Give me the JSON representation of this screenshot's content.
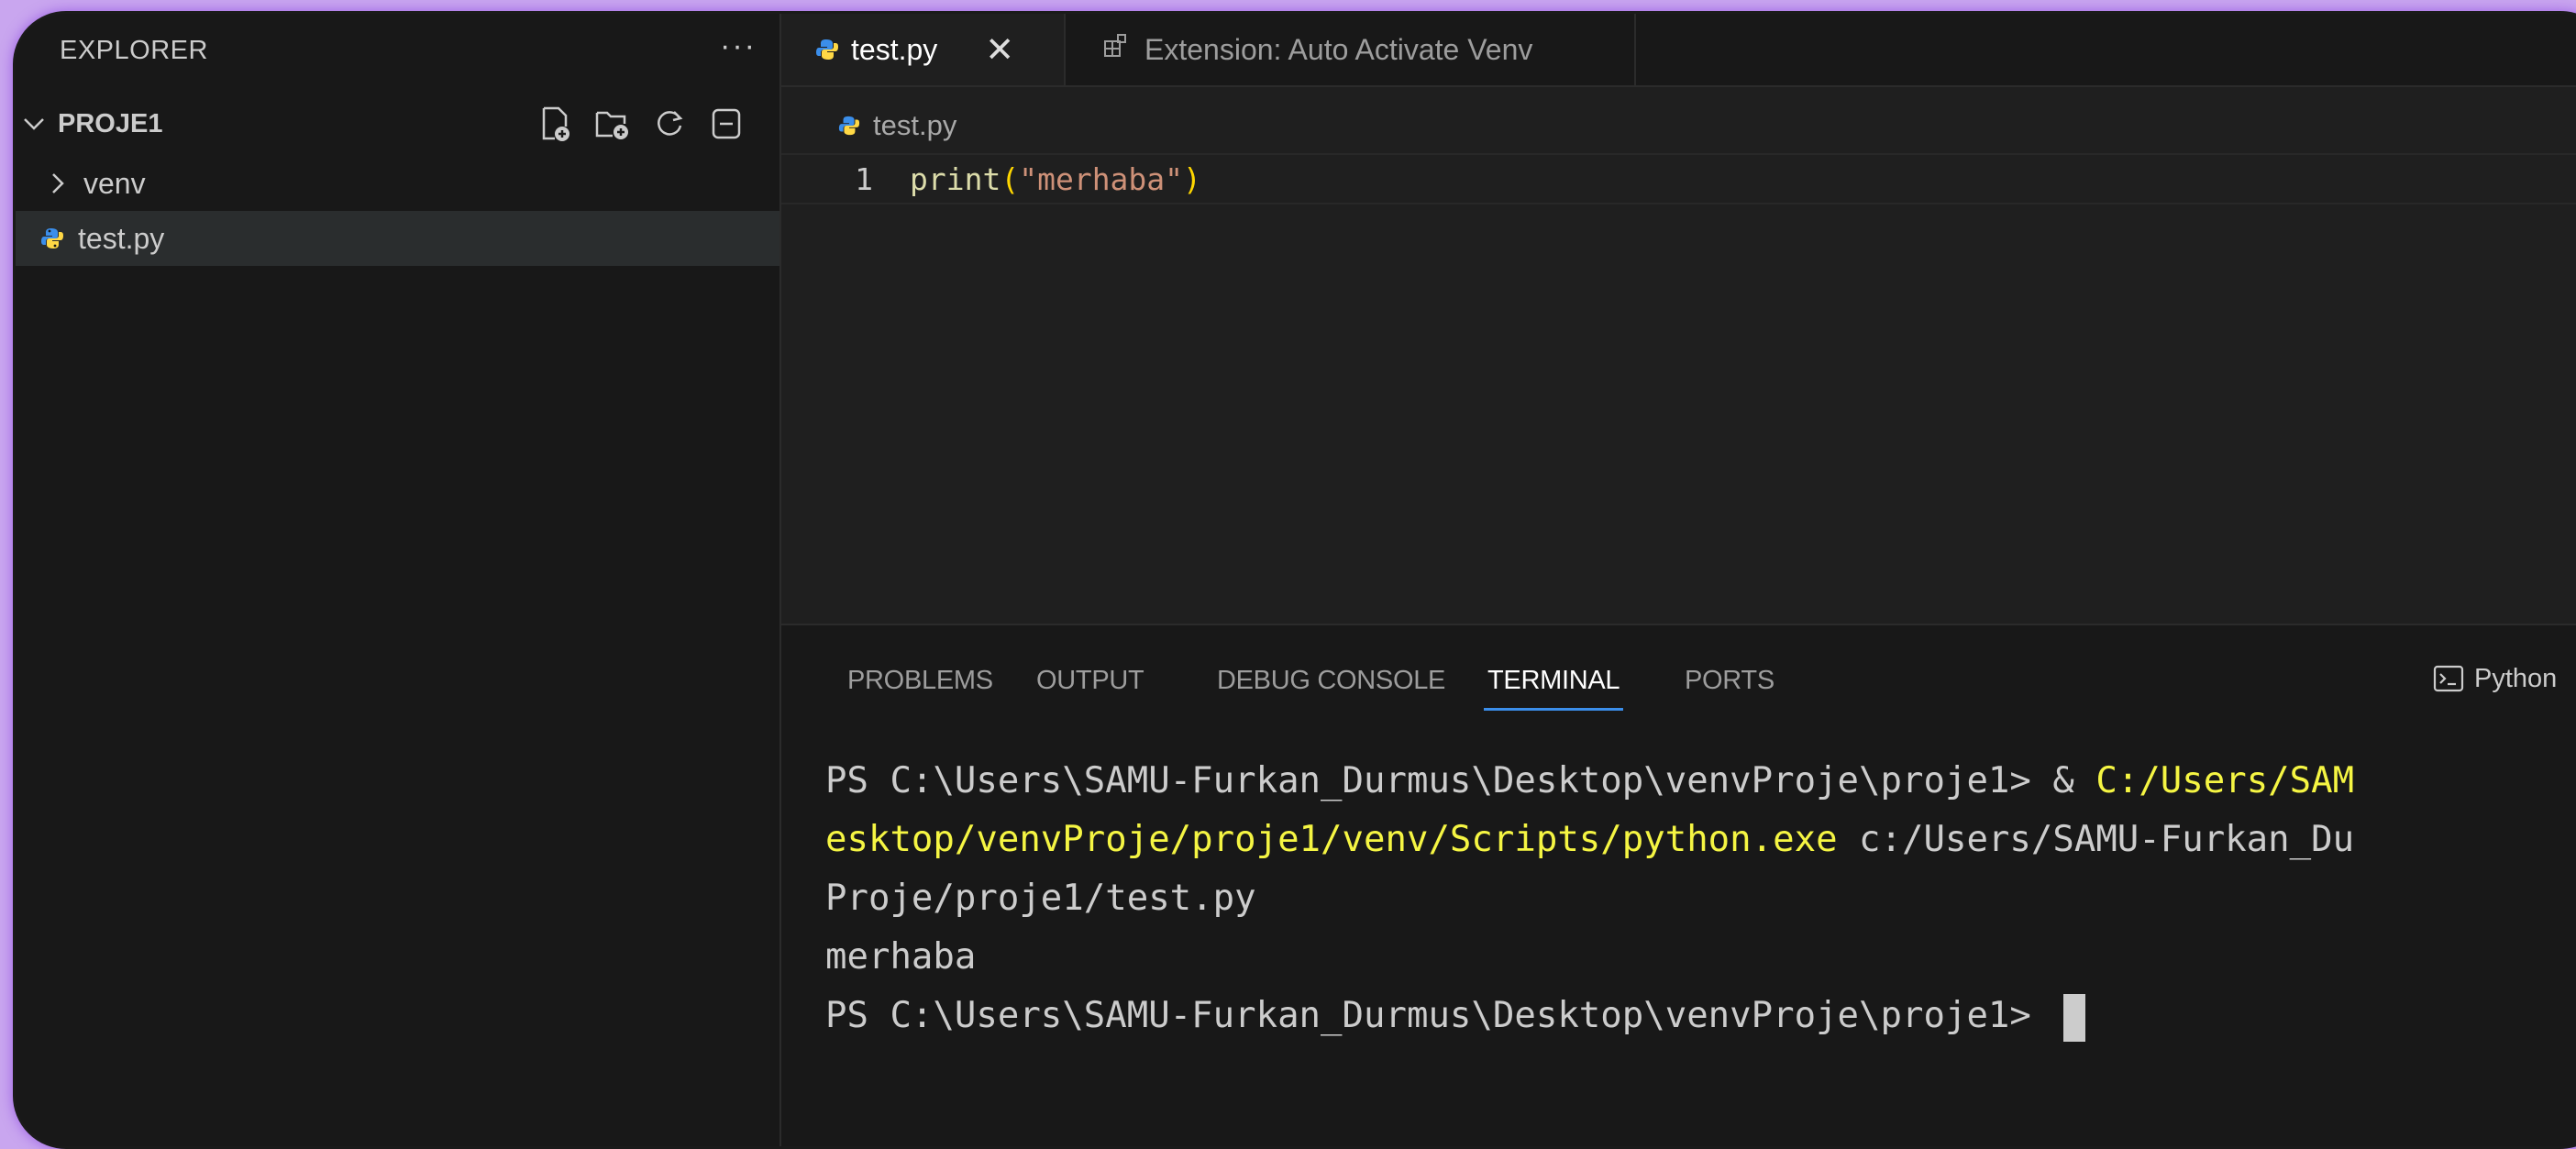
{
  "sidebar": {
    "title": "EXPLORER",
    "more": "···",
    "project": "PROJE1",
    "items": [
      {
        "label": "venv",
        "icon": "chevron-right-icon"
      },
      {
        "label": "test.py",
        "icon": "python-icon"
      }
    ],
    "actions": [
      "new-file-icon",
      "new-folder-icon",
      "refresh-icon",
      "collapse-all-icon"
    ]
  },
  "editor": {
    "tabs": [
      {
        "label": "test.py",
        "close": "✕",
        "active": true
      },
      {
        "label": "Extension: Auto Activate Venv",
        "active": false
      }
    ],
    "breadcrumb": "test.py",
    "lines": [
      {
        "number": "1",
        "fn": "print",
        "open": "(",
        "str": "\"merhaba\"",
        "close": ")"
      }
    ]
  },
  "panel": {
    "tabs": [
      "PROBLEMS",
      "OUTPUT",
      "DEBUG CONSOLE",
      "TERMINAL",
      "PORTS"
    ],
    "active_tab": "TERMINAL",
    "shell": "Python",
    "terminal": {
      "line1_prompt": "PS C:\\Users\\SAMU-Furkan_Durmus\\Desktop\\venvProje\\proje1> & ",
      "line1_path": "C:/Users/SAM",
      "line2_path": "esktop/venvProje/proje1/venv/Scripts/python.exe",
      "line2_rest": " c:/Users/SAMU-Furkan_Du",
      "line3": "Proje/proje1/test.py",
      "line4": "merhaba",
      "line5": "PS C:\\Users\\SAMU-Furkan_Durmus\\Desktop\\venvProje\\proje1> "
    }
  },
  "colors": {
    "background": "#181818",
    "string": "#ce9178",
    "function": "#dcdcaa",
    "terminal_path": "#f5f543",
    "accent": "#3b8eea"
  }
}
